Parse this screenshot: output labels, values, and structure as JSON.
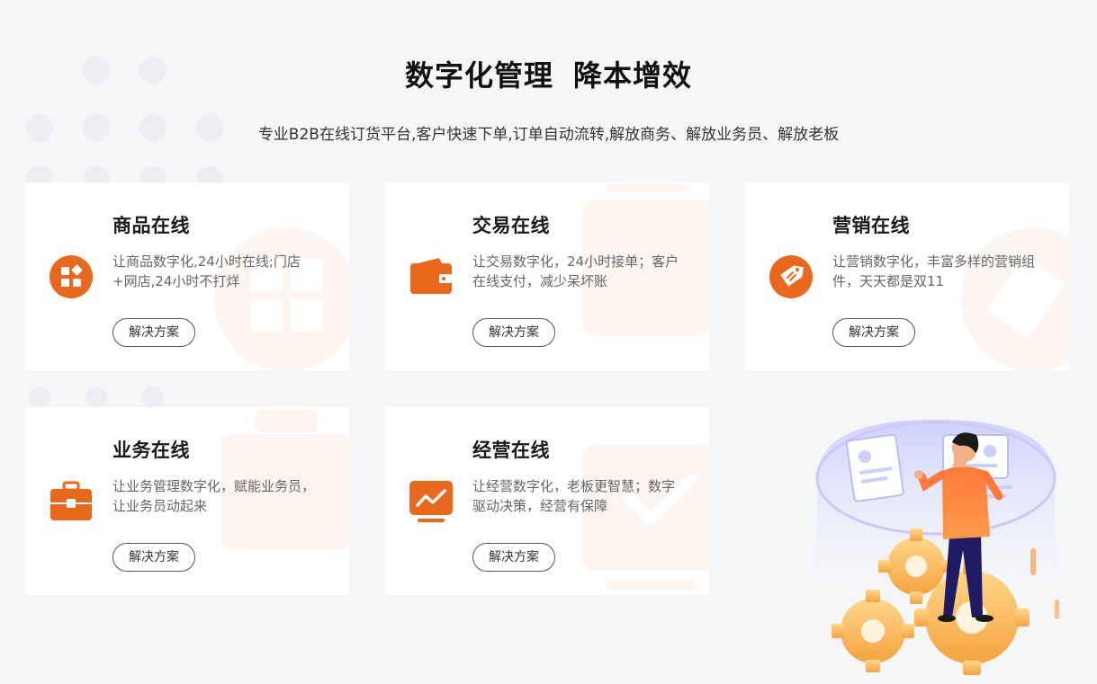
{
  "header": {
    "title_part1": "数字化管理",
    "title_part2": "降本增效",
    "subtitle": "专业B2B在线订货平台,客户快速下单,订单自动流转,解放商务、解放业务员、解放老板"
  },
  "colors": {
    "accent": "#e8691c",
    "background": "#f5f6f8",
    "card": "#ffffff"
  },
  "cards": [
    {
      "title": "商品在线",
      "desc": "让商品数字化,24小时在线;门店+网店,24小时不打烊",
      "button": "解决方案",
      "icon": "product-grid-icon"
    },
    {
      "title": "交易在线",
      "desc": "让交易数字化，24小时接单；客户在线支付，减少呆坏账",
      "button": "解决方案",
      "icon": "wallet-icon"
    },
    {
      "title": "营销在线",
      "desc": "让营销数字化，丰富多样的营销组件，天天都是双11",
      "button": "解决方案",
      "icon": "price-tag-icon"
    },
    {
      "title": "业务在线",
      "desc": "让业务管理数字化，赋能业务员，让业务员动起来",
      "button": "解决方案",
      "icon": "briefcase-icon"
    },
    {
      "title": "经营在线",
      "desc": "让经营数字化，老板更智慧；数字驱动决策，经营有保障",
      "button": "解决方案",
      "icon": "trend-chart-icon"
    }
  ]
}
